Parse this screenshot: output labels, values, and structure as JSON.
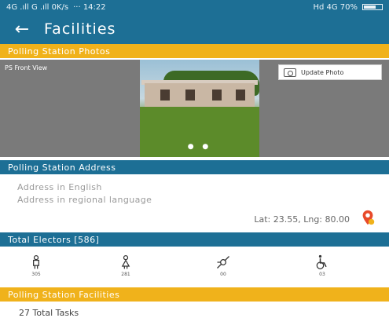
{
  "statusbar": {
    "left": "4G .ıll G .ıll 0K/s",
    "time": "··· 14:22",
    "right": "Hd 4G 70%",
    "battery_level": 0.7
  },
  "appbar": {
    "back_icon": "arrow-left-icon",
    "title": "Facilities"
  },
  "photos_section": {
    "header": "Polling Station Photos",
    "photo_label": "PS Front View",
    "update_button": "Update Photo",
    "dots": "● ●"
  },
  "address_section": {
    "header": "Polling Station Address",
    "line_en": "Address in English",
    "line_regional": "Address in regional language",
    "latlng": "Lat: 23.55, Lng: 80.00",
    "map_icon": "map-pin-icon"
  },
  "electors": {
    "header": "Total Electors [586]",
    "items": [
      {
        "icon": "male-icon",
        "count": "305"
      },
      {
        "icon": "female-icon",
        "count": "281"
      },
      {
        "icon": "third-gender-icon",
        "count": "00"
      },
      {
        "icon": "wheelchair-icon",
        "count": "03"
      }
    ]
  },
  "facilities_section": {
    "header": "Polling Station Facilities",
    "first_item": "27 Total Tasks"
  },
  "colors": {
    "primary": "#1d6f95",
    "accent": "#f0b21b"
  }
}
